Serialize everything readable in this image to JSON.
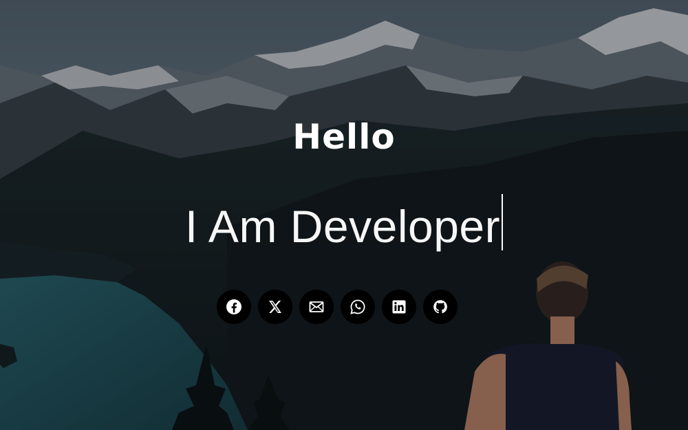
{
  "hero": {
    "greeting": "Hello",
    "typed_text": "I Am Developer",
    "background_image": "mountain-lake-landscape"
  },
  "socials": [
    {
      "name": "facebook",
      "icon": "facebook-icon"
    },
    {
      "name": "x",
      "icon": "x-icon"
    },
    {
      "name": "email",
      "icon": "mail-icon"
    },
    {
      "name": "whatsapp",
      "icon": "whatsapp-icon"
    },
    {
      "name": "linkedin",
      "icon": "linkedin-icon"
    },
    {
      "name": "github",
      "icon": "github-icon"
    }
  ],
  "colors": {
    "text": "#ffffff",
    "icon_bg": "#000000",
    "overlay": "rgba(8,12,16,0.35)"
  }
}
